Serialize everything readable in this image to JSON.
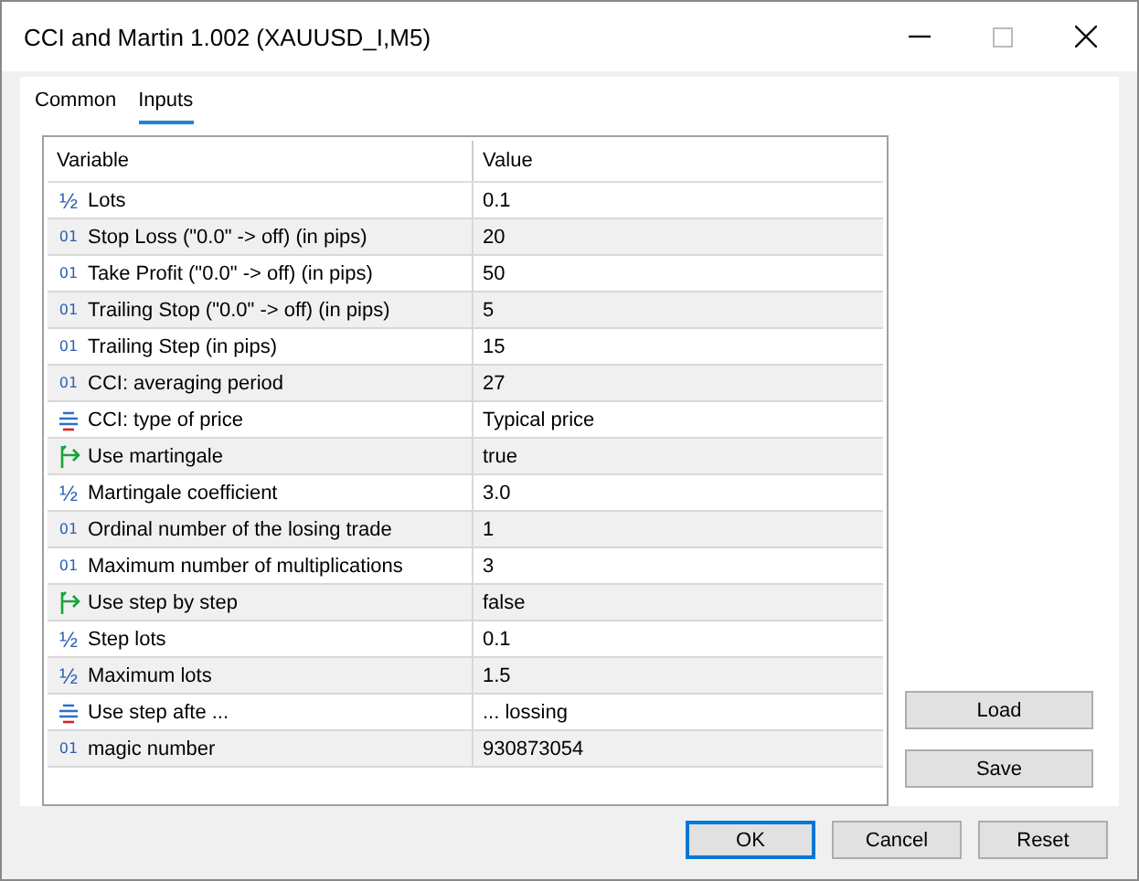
{
  "window": {
    "title": "CCI and Martin 1.002 (XAUUSD_I,M5)"
  },
  "tabs": [
    {
      "label": "Common",
      "selected": false
    },
    {
      "label": "Inputs",
      "selected": true
    }
  ],
  "table": {
    "columns": [
      "Variable",
      "Value"
    ],
    "rows": [
      {
        "kind": "double",
        "icon": "½",
        "variable": "Lots",
        "value": "0.1"
      },
      {
        "kind": "int",
        "icon": "01",
        "variable": "Stop Loss (\"0.0\" -> off) (in pips)",
        "value": "20"
      },
      {
        "kind": "int",
        "icon": "01",
        "variable": "Take Profit (\"0.0\" -> off) (in pips)",
        "value": "50"
      },
      {
        "kind": "int",
        "icon": "01",
        "variable": "Trailing Stop (\"0.0\" -> off) (in pips)",
        "value": "5"
      },
      {
        "kind": "int",
        "icon": "01",
        "variable": "Trailing Step (in pips)",
        "value": "15"
      },
      {
        "kind": "int",
        "icon": "01",
        "variable": "CCI: averaging period",
        "value": "27"
      },
      {
        "kind": "enum",
        "variable": "CCI: type of price",
        "value": "Typical price"
      },
      {
        "kind": "bool",
        "variable": "Use martingale",
        "value": "true"
      },
      {
        "kind": "double",
        "icon": "½",
        "variable": "Martingale coefficient",
        "value": "3.0"
      },
      {
        "kind": "int",
        "icon": "01",
        "variable": "Ordinal number of the losing trade",
        "value": "1"
      },
      {
        "kind": "int",
        "icon": "01",
        "variable": "Maximum number of multiplications",
        "value": "3"
      },
      {
        "kind": "bool",
        "variable": "Use step by step",
        "value": "false"
      },
      {
        "kind": "double",
        "icon": "½",
        "variable": "Step lots",
        "value": "0.1"
      },
      {
        "kind": "double",
        "icon": "½",
        "variable": "Maximum lots",
        "value": "1.5"
      },
      {
        "kind": "enum",
        "variable": "Use step afte ...",
        "value": "... lossing"
      },
      {
        "kind": "int",
        "icon": "01",
        "variable": "magic number",
        "value": "930873054"
      }
    ]
  },
  "side_buttons": [
    "Load",
    "Save"
  ],
  "buttons": [
    {
      "label": "OK",
      "default": true
    },
    {
      "label": "Cancel",
      "default": false
    },
    {
      "label": "Reset",
      "default": false
    }
  ]
}
